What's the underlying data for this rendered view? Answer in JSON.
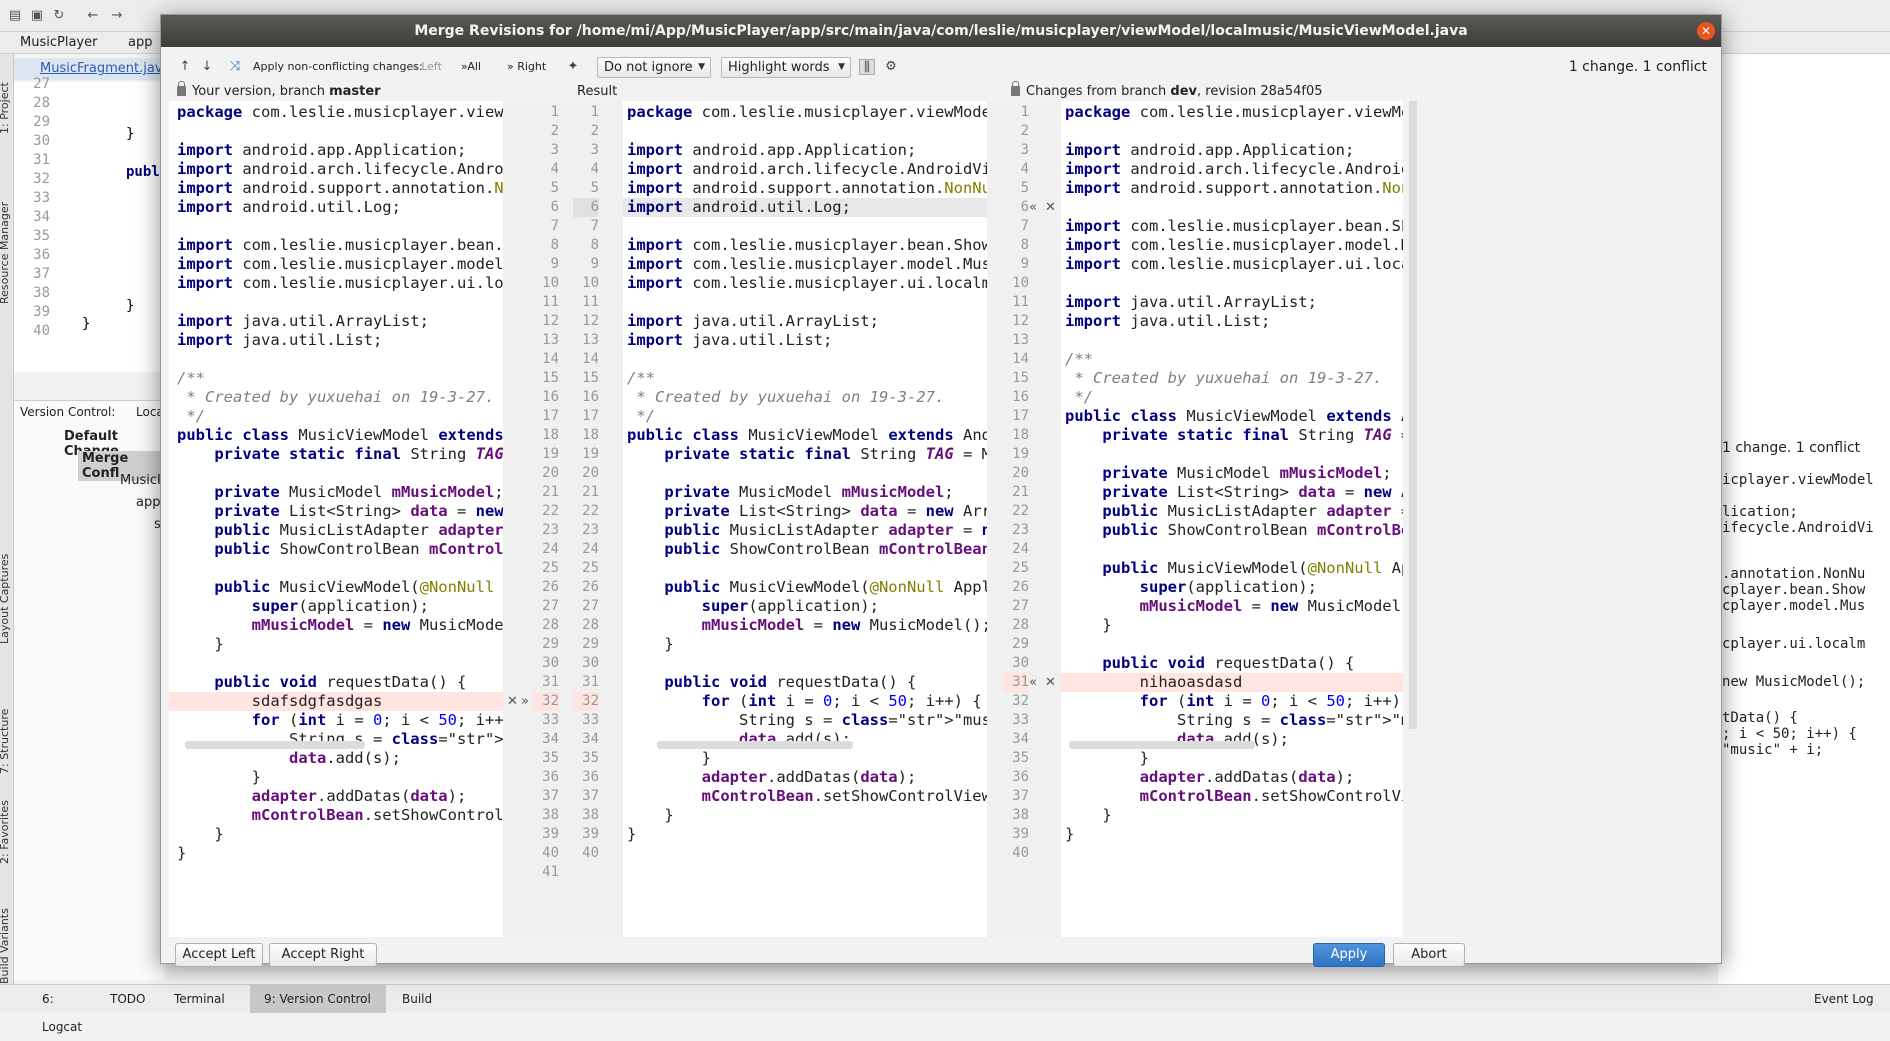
{
  "ide": {
    "project": "MusicPlayer",
    "module": "app",
    "editor_tab": "MusicFragment.java",
    "bg_line_numbers": [
      "27",
      "28",
      "29",
      "30",
      "31",
      "32",
      "33",
      "34",
      "35",
      "36",
      "37",
      "38",
      "39",
      "40"
    ],
    "bg_code": [
      "}",
      "publ",
      "}",
      "}"
    ],
    "vc_header": "Version Control:",
    "vc_tab": "Local",
    "vc_tree": [
      "Default Change",
      "Merge Confl",
      "MusicI",
      "app",
      "s"
    ],
    "stripe_labels": [
      "1: Project",
      "Resource Manager",
      "Layout Captures",
      "7: Structure",
      "2: Favorites",
      "Build Variants"
    ],
    "bottom_tabs": [
      "6: Logcat",
      "TODO",
      "Terminal",
      "9: Version Control",
      "Build"
    ],
    "event_log": "Event Log",
    "right_status": "1 change. 1 conflict",
    "right_code": [
      "icplayer.viewModel",
      "lication;",
      "ifecycle.AndroidVi",
      ".annotation.NonNu",
      "cplayer.bean.Show",
      "cplayer.model.Mus",
      "cplayer.ui.localm",
      "new MusicModel();",
      "tData() {",
      "; i < 50; i++) {",
      "\"music\" + i;",
      ");"
    ]
  },
  "dialog": {
    "title": "Merge Revisions for /home/mi/App/MusicPlayer/app/src/main/java/com/leslie/musicplayer/viewModel/localmusic/MusicViewModel.java",
    "toolbar": {
      "apply_non_conflicting": "Apply non-conflicting changes:",
      "left": "Left",
      "all": "All",
      "right": "Right",
      "ignore_option": "Do not ignore",
      "highlight_option": "Highlight words",
      "status": "1 change. 1 conflict"
    },
    "left_header_prefix": "Your version, branch",
    "left_header_branch": "master",
    "result_header": "Result",
    "right_header_prefix": "Changes from branch",
    "right_header_branch": "dev",
    "right_header_suffix": ", revision 28a54f05",
    "buttons": {
      "accept_left": "Accept Left",
      "accept_right": "Accept Right",
      "apply": "Apply",
      "abort": "Abort"
    },
    "left_lines": [
      "package com.leslie.musicplayer.viewModel.",
      "",
      "import android.app.Application;",
      "import android.arch.lifecycle.AndroidView",
      "import android.support.annotation.NonNull",
      "import android.util.Log;",
      "",
      "import com.leslie.musicplayer.bean.ShowCo",
      "import com.leslie.musicplayer.model.Music",
      "import com.leslie.musicplayer.ui.localmus",
      "",
      "import java.util.ArrayList;",
      "import java.util.List;",
      "",
      "/**",
      " * Created by yuxuehai on 19-3-27.",
      " */",
      "public class MusicViewModel extends Andro",
      "    private static final String TAG = Mus",
      "",
      "    private MusicModel mMusicModel;",
      "    private List<String> data = new Array",
      "    public MusicListAdapter adapter = new",
      "    public ShowControlBean mControlBean =",
      "",
      "    public MusicViewModel(@NonNull Applic",
      "        super(application);",
      "        mMusicModel = new MusicModel();",
      "    }",
      "",
      "    public void requestData() {",
      "        sdafsdgfasdgas",
      "        for (int i = 0; i < 50; i++) {",
      "            String s = \"music\" + i;",
      "            data.add(s);",
      "        }",
      "        adapter.addDatas(data);",
      "        mControlBean.setShowControlView(!",
      "    }",
      "}",
      ""
    ],
    "result_lines": [
      "package com.leslie.musicplayer.viewModel.lo",
      "",
      "import android.app.Application;",
      "import android.arch.lifecycle.AndroidViewMo",
      "import android.support.annotation.NonNull;",
      "import android.util.Log;",
      "",
      "import com.leslie.musicplayer.bean.ShowContr",
      "import com.leslie.musicplayer.model.MusicMo",
      "import com.leslie.musicplayer.ui.localmusic.",
      "",
      "import java.util.ArrayList;",
      "import java.util.List;",
      "",
      "/**",
      " * Created by yuxuehai on 19-3-27.",
      " */",
      "public class MusicViewModel extends AndroidV",
      "    private static final String TAG = MusicV",
      "",
      "    private MusicModel mMusicModel;",
      "    private List<String> data = new ArrayLis",
      "    public MusicListAdapter adapter = new Mu",
      "    public ShowControlBean mControlBean = ne",
      "",
      "    public MusicViewModel(@NonNull Applicati",
      "        super(application);",
      "        mMusicModel = new MusicModel();",
      "    }",
      "",
      "    public void requestData() {",
      "        for (int i = 0; i < 50; i++) {",
      "            String s = \"music\" + i;",
      "            data.add(s);",
      "        }",
      "        adapter.addDatas(data);",
      "        mControlBean.setShowControlView(!dat",
      "    }",
      "}",
      "",
      ""
    ],
    "right_lines": [
      "package com.leslie.musicplayer.viewModel.lo",
      "",
      "import android.app.Application;",
      "import android.arch.lifecycle.AndroidViewMo",
      "import android.support.annotation.NonNull;",
      "",
      "import com.leslie.musicplayer.bean.ShowCont",
      "import com.leslie.musicplayer.model.MusicMo",
      "import com.leslie.musicplayer.ui.localmusic",
      "",
      "import java.util.ArrayList;",
      "import java.util.List;",
      "",
      "/**",
      " * Created by yuxuehai on 19-3-27.",
      " */",
      "public class MusicViewModel extends Androic",
      "    private static final String TAG = Music",
      "",
      "    private MusicModel mMusicModel;",
      "    private List<String> data = new ArrayLi",
      "    public MusicListAdapter adapter = new M",
      "    public ShowControlBean mControlBean = n",
      "",
      "    public MusicViewModel(@NonNull Applicat",
      "        super(application);",
      "        mMusicModel = new MusicModel();",
      "    }",
      "",
      "    public void requestData() {",
      "        nihaoasdasd",
      "        for (int i = 0; i < 50; i++) {",
      "            String s = \"music\" + i;",
      "            data.add(s);",
      "        }",
      "        adapter.addDatas(data);",
      "        mControlBean.setShowControlView(!da",
      "    }",
      "}",
      ""
    ],
    "left_numbers": [
      "1",
      "2",
      "3",
      "4",
      "5",
      "6",
      "7",
      "8",
      "9",
      "10",
      "11",
      "12",
      "13",
      "14",
      "15",
      "16",
      "17",
      "18",
      "19",
      "20",
      "21",
      "22",
      "23",
      "24",
      "25",
      "26",
      "27",
      "28",
      "29",
      "30",
      "31",
      "32",
      "33",
      "34",
      "35",
      "36",
      "37",
      "38",
      "39",
      "40",
      "41"
    ],
    "result_numbers": [
      "1",
      "2",
      "3",
      "4",
      "5",
      "6",
      "7",
      "8",
      "9",
      "10",
      "11",
      "12",
      "13",
      "14",
      "15",
      "16",
      "17",
      "18",
      "19",
      "20",
      "21",
      "22",
      "23",
      "24",
      "25",
      "26",
      "27",
      "28",
      "29",
      "30",
      "31",
      "32",
      "33",
      "34",
      "35",
      "36",
      "37",
      "38",
      "39",
      "40"
    ],
    "right_numbers": [
      "1",
      "2",
      "3",
      "4",
      "5",
      "6",
      "7",
      "8",
      "9",
      "10",
      "11",
      "12",
      "13",
      "14",
      "15",
      "16",
      "17",
      "18",
      "19",
      "20",
      "21",
      "22",
      "23",
      "24",
      "25",
      "26",
      "27",
      "28",
      "29",
      "30",
      "31",
      "32",
      "33",
      "34",
      "35",
      "36",
      "37",
      "38",
      "39",
      "40"
    ],
    "colors": {
      "conflict_bg": "#ffe4e1",
      "removed_bg": "#e8e8e8",
      "keyword": "#000080",
      "string": "#008000",
      "number": "#0000ff",
      "field": "#660e7a",
      "comment": "#808080",
      "annotation": "#808000",
      "apply_button": "#3a80cc",
      "title_bar": "#4a4945",
      "close_button": "#e95420"
    }
  }
}
